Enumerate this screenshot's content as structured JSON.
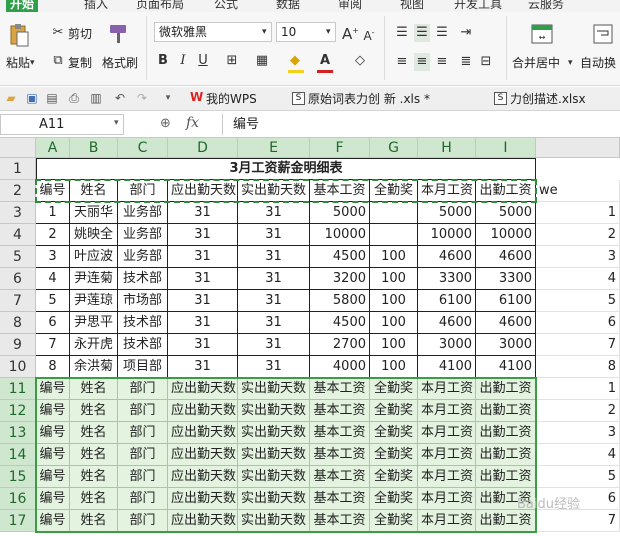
{
  "menu": {
    "tabs": [
      "开始",
      "插入",
      "页面布局",
      "公式",
      "数据",
      "审阅",
      "视图",
      "开发工具",
      "云服务"
    ]
  },
  "ribbon": {
    "paste_label": "粘贴",
    "cut_label": "剪切",
    "copy_label": "复制",
    "format_painter_label": "格式刷",
    "font_name": "微软雅黑",
    "font_size": "10",
    "merge_label": "合并居中",
    "autowrap_label": "自动换"
  },
  "doc_tabs": {
    "wps_label": "我的WPS",
    "file1": "原始词表力创 新 .xls *",
    "file2": "力创描述.xlsx"
  },
  "formula": {
    "cell_ref": "A11",
    "fx": "fx",
    "content": "编号"
  },
  "sheet": {
    "columns": [
      "A",
      "B",
      "C",
      "D",
      "E",
      "F",
      "G",
      "H",
      "I"
    ],
    "rows": [
      "1",
      "2",
      "3",
      "4",
      "5",
      "6",
      "7",
      "8",
      "9",
      "10",
      "11",
      "12",
      "13",
      "14",
      "15",
      "16",
      "17"
    ],
    "title": "3月工资薪金明细表",
    "headers": [
      "编号",
      "姓名",
      "部门",
      "应出勤天数",
      "实出勤天数",
      "基本工资",
      "全勤奖",
      "本月工资",
      "出勤工资"
    ],
    "extra_header": "we",
    "data": [
      [
        "1",
        "天丽华",
        "业务部",
        "31",
        "31",
        "5000",
        "",
        "5000",
        "5000"
      ],
      [
        "2",
        "姚映全",
        "业务部",
        "31",
        "31",
        "10000",
        "",
        "10000",
        "10000"
      ],
      [
        "3",
        "叶应波",
        "业务部",
        "31",
        "31",
        "4500",
        "100",
        "4600",
        "4600"
      ],
      [
        "4",
        "尹连菊",
        "技术部",
        "31",
        "31",
        "3200",
        "100",
        "3300",
        "3300"
      ],
      [
        "5",
        "尹莲琼",
        "市场部",
        "31",
        "31",
        "5800",
        "100",
        "6100",
        "6100"
      ],
      [
        "6",
        "尹思平",
        "技术部",
        "31",
        "31",
        "4500",
        "100",
        "4600",
        "4600"
      ],
      [
        "7",
        "永开虎",
        "技术部",
        "31",
        "31",
        "2700",
        "100",
        "3000",
        "3000"
      ],
      [
        "8",
        "余洪菊",
        "项目部",
        "31",
        "31",
        "4000",
        "100",
        "4100",
        "4100"
      ]
    ],
    "extra_col": [
      "1",
      "2",
      "3",
      "4",
      "5",
      "6",
      "7",
      "8",
      "1",
      "2",
      "3",
      "4",
      "5",
      "6",
      "7"
    ],
    "watermark": "Baidu经验"
  }
}
